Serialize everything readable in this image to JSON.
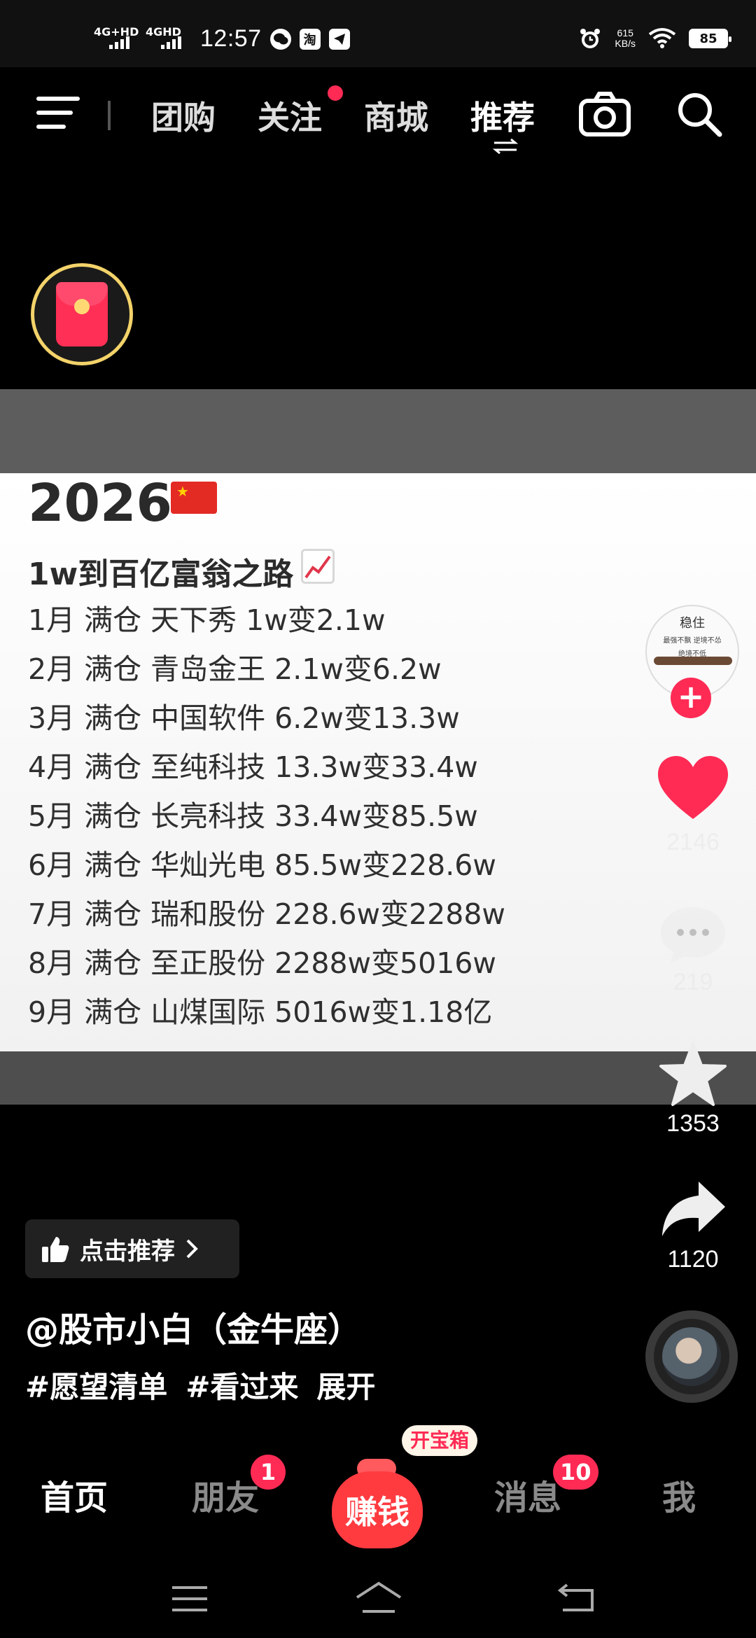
{
  "status_bar": {
    "net1": "4G+HD",
    "net2": "4GHD",
    "time": "12:57",
    "app_icon_wechat": "wechat-icon",
    "app_icon_taobao": "淘",
    "app_icon_telegram": "telegram-icon",
    "speed_value": "615",
    "speed_unit": "KB/s",
    "battery": "85"
  },
  "top_nav": {
    "tabs": [
      {
        "label": "团购"
      },
      {
        "label": "关注"
      },
      {
        "label": "商城"
      },
      {
        "label": "推荐"
      }
    ],
    "active_tab": "推荐"
  },
  "video": {
    "year": "2026",
    "slogan": "1w到百亿富翁之路",
    "lines": [
      "1月 满仓 天下秀 1w变2.1w",
      "2月 满仓 青岛金王 2.1w变6.2w",
      "3月 满仓 中国软件 6.2w变13.3w",
      "4月 满仓 至纯科技 13.3w变33.4w",
      "5月 满仓 长亮科技 33.4w变85.5w",
      "6月 满仓 华灿光电 85.5w变228.6w",
      "7月 满仓 瑞和股份 228.6w变2288w",
      "8月 满仓 至正股份 2288w变5016w",
      "9月 满仓 山煤国际 5016w变1.18亿"
    ]
  },
  "right_rail": {
    "avatar_text": "稳住",
    "avatar_small1": "最强不飘 逆境不怂",
    "avatar_small2": "绝境不低",
    "likes": "2146",
    "comments": "219",
    "favorites": "1353",
    "shares": "1120"
  },
  "bottom_info": {
    "recommend_label": "点击推荐",
    "author": "@股市小白（金牛座）",
    "tags": [
      "#愿望清单",
      "#看过来",
      "展开"
    ]
  },
  "tab_bar": {
    "home": "首页",
    "friends": "朋友",
    "friends_badge": "1",
    "earn": "赚钱",
    "earn_tag": "开宝箱",
    "messages": "消息",
    "messages_badge": "10",
    "me": "我"
  },
  "colors": {
    "accent": "#ff2b55",
    "envelope_ring": "#f3d36a",
    "background": "#000000"
  }
}
